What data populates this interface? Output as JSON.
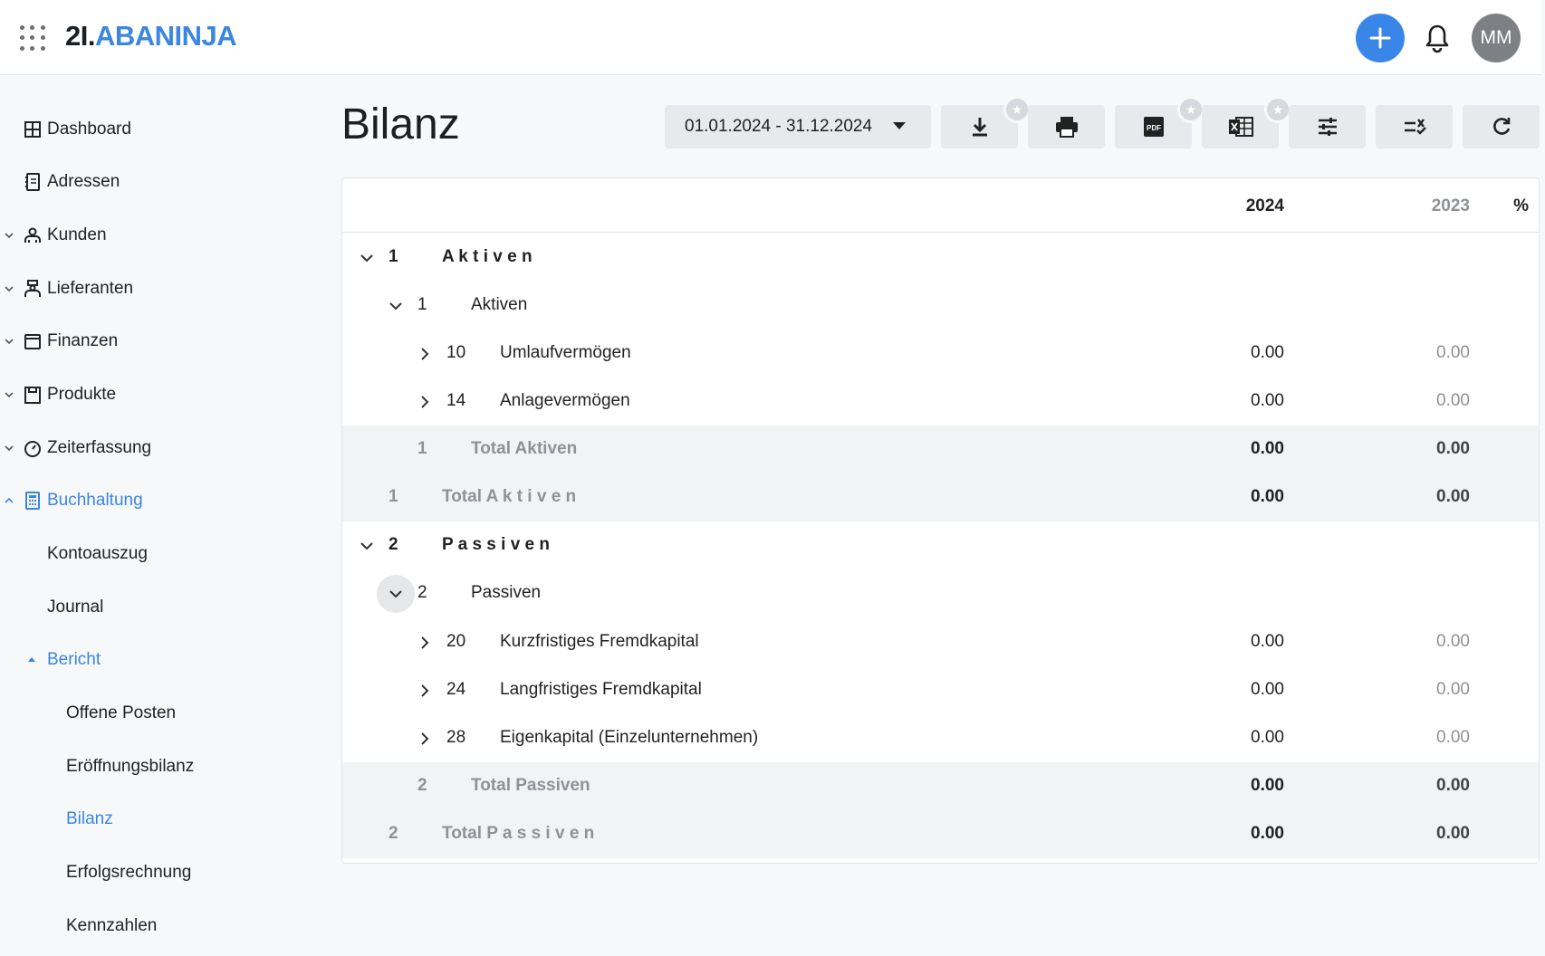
{
  "header": {
    "logo_num": "2",
    "logo_sep": "I.",
    "logo_brand": "ABANINJA",
    "avatar_initials": "MM"
  },
  "sidebar": {
    "items": [
      {
        "label": "Dashboard",
        "icon": "dashboard-icon"
      },
      {
        "label": "Adressen",
        "icon": "address-book-icon"
      },
      {
        "label": "Kunden",
        "icon": "customers-icon"
      },
      {
        "label": "Lieferanten",
        "icon": "suppliers-icon"
      },
      {
        "label": "Finanzen",
        "icon": "finance-icon"
      },
      {
        "label": "Produkte",
        "icon": "products-icon"
      },
      {
        "label": "Zeiterfassung",
        "icon": "timer-icon"
      },
      {
        "label": "Buchhaltung",
        "icon": "calculator-icon"
      },
      {
        "label": "Kontoauszug"
      },
      {
        "label": "Journal"
      },
      {
        "label": "Bericht"
      },
      {
        "label": "Offene Posten"
      },
      {
        "label": "Eröffnungsbilanz"
      },
      {
        "label": "Bilanz"
      },
      {
        "label": "Erfolgsrechnung"
      },
      {
        "label": "Kennzahlen"
      }
    ]
  },
  "main": {
    "title": "Bilanz",
    "date_range": "01.01.2024 - 31.12.2024",
    "table": {
      "headers": {
        "year1": "2024",
        "year2": "2023",
        "pct": "%"
      },
      "rows": [
        {
          "num": "1",
          "label": "A k t i v e n"
        },
        {
          "num": "1",
          "label": "Aktiven"
        },
        {
          "num": "10",
          "label": "Umlaufvermögen",
          "v1": "0.00",
          "v2": "0.00"
        },
        {
          "num": "14",
          "label": "Anlagevermögen",
          "v1": "0.00",
          "v2": "0.00"
        },
        {
          "num": "1",
          "label": "Total Aktiven",
          "v1": "0.00",
          "v2": "0.00"
        },
        {
          "num": "1",
          "label_prefix": "Total",
          "label": "A k t i v e n",
          "v1": "0.00",
          "v2": "0.00"
        },
        {
          "num": "2",
          "label": "P a s s i v e n"
        },
        {
          "num": "2",
          "label": "Passiven"
        },
        {
          "num": "20",
          "label": "Kurzfristiges Fremdkapital",
          "v1": "0.00",
          "v2": "0.00"
        },
        {
          "num": "24",
          "label": "Langfristiges Fremdkapital",
          "v1": "0.00",
          "v2": "0.00"
        },
        {
          "num": "28",
          "label": "Eigenkapital (Einzelunternehmen)",
          "v1": "0.00",
          "v2": "0.00"
        },
        {
          "num": "2",
          "label": "Total Passiven",
          "v1": "0.00",
          "v2": "0.00"
        },
        {
          "num": "2",
          "label_prefix": "Total",
          "label": "P a s s i v e n",
          "v1": "0.00",
          "v2": "0.00"
        }
      ]
    }
  },
  "colors": {
    "accent": "#3b86e0",
    "fab": "#3a86e8",
    "avatar": "#7d8084"
  }
}
